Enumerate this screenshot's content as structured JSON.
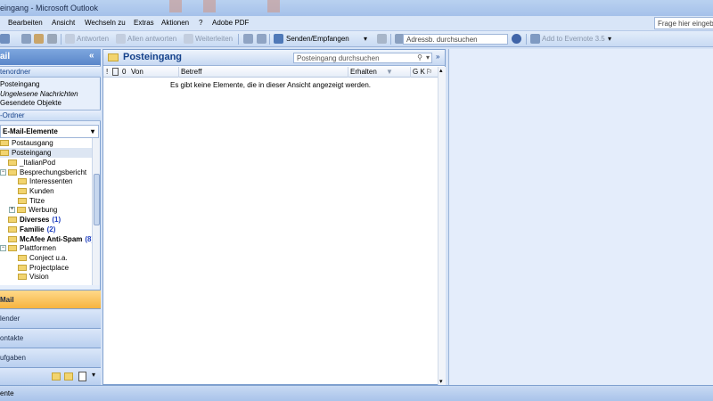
{
  "window": {
    "title": "eingang - Microsoft Outlook"
  },
  "menu": {
    "items": [
      "Bearbeiten",
      "Ansicht",
      "Wechseln zu",
      "Extras",
      "Aktionen",
      "?",
      "Adobe PDF"
    ],
    "help_placeholder": "Frage hier eingeben"
  },
  "toolbar": {
    "reply_all": "Allen antworten",
    "reply": "Antworten",
    "forward": "Weiterleiten",
    "send_receive": "Senden/Empfangen",
    "address_placeholder": "Adressb. durchsuchen",
    "evernote": "Add to Evernote 3.5"
  },
  "nav": {
    "header": "ail",
    "collapse_glyph": "«",
    "favorites_title": "tenordner",
    "favorites": [
      "Posteingang",
      "Ungelesene Nachrichten",
      "Gesendete Objekte"
    ],
    "folders_title": "-Ordner",
    "dropdown_label": "E-Mail-Elemente",
    "tree": [
      {
        "label": "Postausgang"
      },
      {
        "label": "Posteingang"
      },
      {
        "label": "_ItalianPod"
      },
      {
        "label": "Besprechungsbericht"
      },
      {
        "label": "Interessenten"
      },
      {
        "label": "Kunden"
      },
      {
        "label": "Titze"
      },
      {
        "label": "Werbung"
      },
      {
        "label": "Diverses",
        "count": "(1)"
      },
      {
        "label": "Familie",
        "count": "(2)"
      },
      {
        "label": "McAfee Anti-Spam",
        "count": "(8)"
      },
      {
        "label": "Plattformen"
      },
      {
        "label": "Conject u.a."
      },
      {
        "label": "Projectplace"
      },
      {
        "label": "Vision"
      }
    ],
    "buttons": [
      "Mail",
      "lender",
      "ontakte",
      "ufgaben"
    ]
  },
  "content": {
    "title": "Posteingang",
    "search_placeholder": "Posteingang durchsuchen",
    "columns": {
      "from": "Von",
      "subject": "Betreff",
      "received": "Erhalten",
      "flags": "G K"
    },
    "empty_message": "Es gibt keine Elemente, die in dieser Ansicht angezeigt werden."
  },
  "status": {
    "text": "ente"
  },
  "colors": {
    "accent": "#15428b",
    "active_tab": "#f6b23b",
    "folder": "#f2d46f"
  }
}
